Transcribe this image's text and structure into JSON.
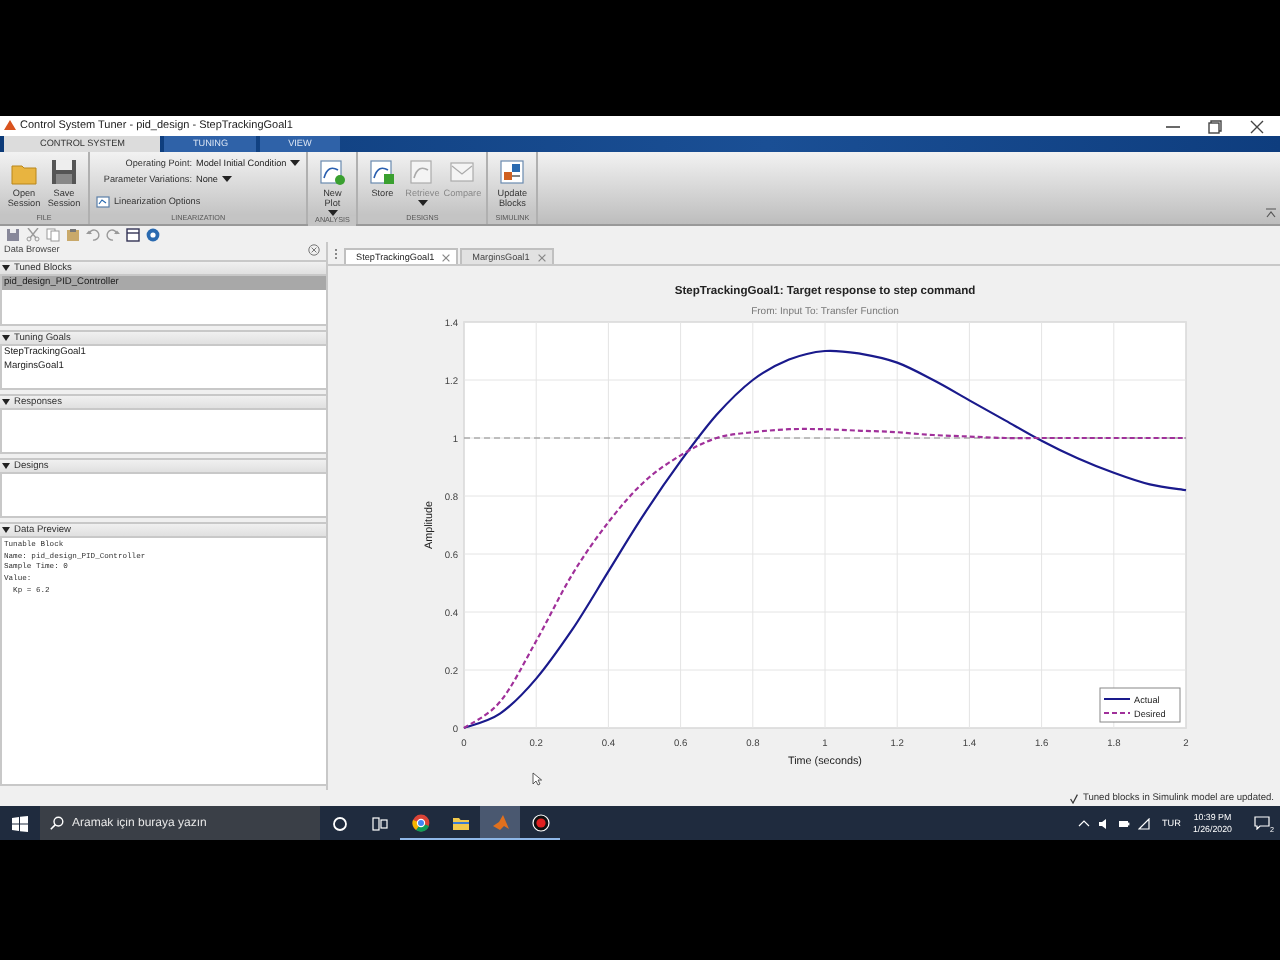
{
  "window": {
    "title": "Control System Tuner - pid_design - StepTrackingGoal1"
  },
  "ribbon_tabs": [
    {
      "label": "CONTROL SYSTEM",
      "selected": true
    },
    {
      "label": "TUNING",
      "selected": false
    },
    {
      "label": "VIEW",
      "selected": false
    }
  ],
  "ribbon_groups": [
    {
      "label": "FILE",
      "controls": [
        {
          "kind": "large",
          "label": "Open Session",
          "dropdown": false,
          "disabled": false
        },
        {
          "kind": "large",
          "label": "Save Session",
          "dropdown": false,
          "disabled": false
        }
      ]
    },
    {
      "label": "LINEARIZATION",
      "controls": [
        {
          "kind": "choice",
          "label": "Operating Point:",
          "value": "Model Initial Condition"
        },
        {
          "kind": "choice",
          "label": "Parameter Variations:",
          "value": "None"
        },
        {
          "kind": "small",
          "label": "Linearization Options",
          "disabled": false
        }
      ]
    },
    {
      "label": "ANALYSIS",
      "controls": [
        {
          "kind": "large",
          "label": "New Plot",
          "dropdown": true,
          "disabled": false
        }
      ]
    },
    {
      "label": "DESIGNS",
      "controls": [
        {
          "kind": "large",
          "label": "Store",
          "dropdown": false,
          "disabled": false
        },
        {
          "kind": "large",
          "label": "Retrieve",
          "dropdown": true,
          "disabled": true
        },
        {
          "kind": "large",
          "label": "Compare",
          "dropdown": false,
          "disabled": true
        }
      ]
    },
    {
      "label": "SIMULINK",
      "controls": [
        {
          "kind": "large",
          "label": "Update Blocks",
          "dropdown": false,
          "disabled": false
        }
      ]
    }
  ],
  "data_browser": {
    "title": "Data Browser",
    "sections": [
      {
        "title": "Tuned Blocks",
        "expanded": true,
        "items": [
          {
            "label": "pid_design_PID_Controller",
            "selected": true
          }
        ]
      },
      {
        "title": "Tuning Goals",
        "expanded": true,
        "items": [
          {
            "label": "StepTrackingGoal1",
            "selected": false
          },
          {
            "label": "MarginsGoal1",
            "selected": false
          }
        ]
      },
      {
        "title": "Responses",
        "expanded": true
      },
      {
        "title": "Designs",
        "expanded": true
      }
    ],
    "data_preview": {
      "title": "Data Preview",
      "lines": [
        "Tunable Block",
        "Name: pid_design_PID_Controller",
        "Sample Time: 0",
        "Value:",
        "  Kp = 6.2"
      ]
    }
  },
  "document_tabs": [
    {
      "label": "StepTrackingGoal1",
      "selected": true
    },
    {
      "label": "MarginsGoal1",
      "selected": false
    }
  ],
  "plot": {
    "chart_data": {
      "type": "line",
      "title": "StepTrackingGoal1: Target response to step command",
      "subtitle": "From: Input  To: Transfer Function",
      "xlabel": "Time (seconds)",
      "ylabel": "Amplitude",
      "x": [
        0,
        0.1,
        0.2,
        0.3,
        0.4,
        0.5,
        0.6,
        0.7,
        0.8,
        0.9,
        1,
        1.1,
        1.2,
        1.3,
        1.4,
        1.5,
        1.6,
        1.7,
        1.8,
        1.9,
        2
      ],
      "series": [
        {
          "name": "Actual",
          "color": "#1a1a8c",
          "line_style": "solid",
          "values": [
            0,
            0.05,
            0.17,
            0.34,
            0.54,
            0.74,
            0.92,
            1.08,
            1.2,
            1.27,
            1.3,
            1.29,
            1.26,
            1.2,
            1.13,
            1.06,
            0.99,
            0.93,
            0.88,
            0.84,
            0.82
          ]
        },
        {
          "name": "Desired",
          "color": "#a0309a",
          "line_style": "dashed",
          "values": [
            0,
            0.09,
            0.3,
            0.53,
            0.71,
            0.85,
            0.94,
            1,
            1.02,
            1.03,
            1.03,
            1.025,
            1.02,
            1.01,
            1.005,
            1,
            1,
            1,
            1,
            1,
            1
          ]
        }
      ],
      "xlim": [
        0,
        2
      ],
      "ylim": [
        0,
        1.4
      ],
      "xticks": [
        0,
        0.2,
        0.4,
        0.6,
        0.8,
        1,
        1.2,
        1.4,
        1.6,
        1.8,
        2
      ],
      "yticks": [
        0,
        0.2,
        0.4,
        0.6,
        0.8,
        1,
        1.2,
        1.4
      ],
      "ref_lines": [
        {
          "axis": "y",
          "value": 1
        }
      ],
      "grid": true,
      "legend": true
    }
  },
  "status": "Tuned blocks in Simulink model are updated.",
  "taskbar": {
    "search_placeholder": "Aramak için buraya yazın",
    "apps": [
      {
        "running": true,
        "selected": false
      },
      {
        "running": true,
        "selected": false
      },
      {
        "running": true,
        "selected": true
      },
      {
        "running": true,
        "selected": false
      }
    ],
    "language": "TUR",
    "time": "10:39 PM",
    "date": "1/26/2020",
    "notifications": "2"
  }
}
